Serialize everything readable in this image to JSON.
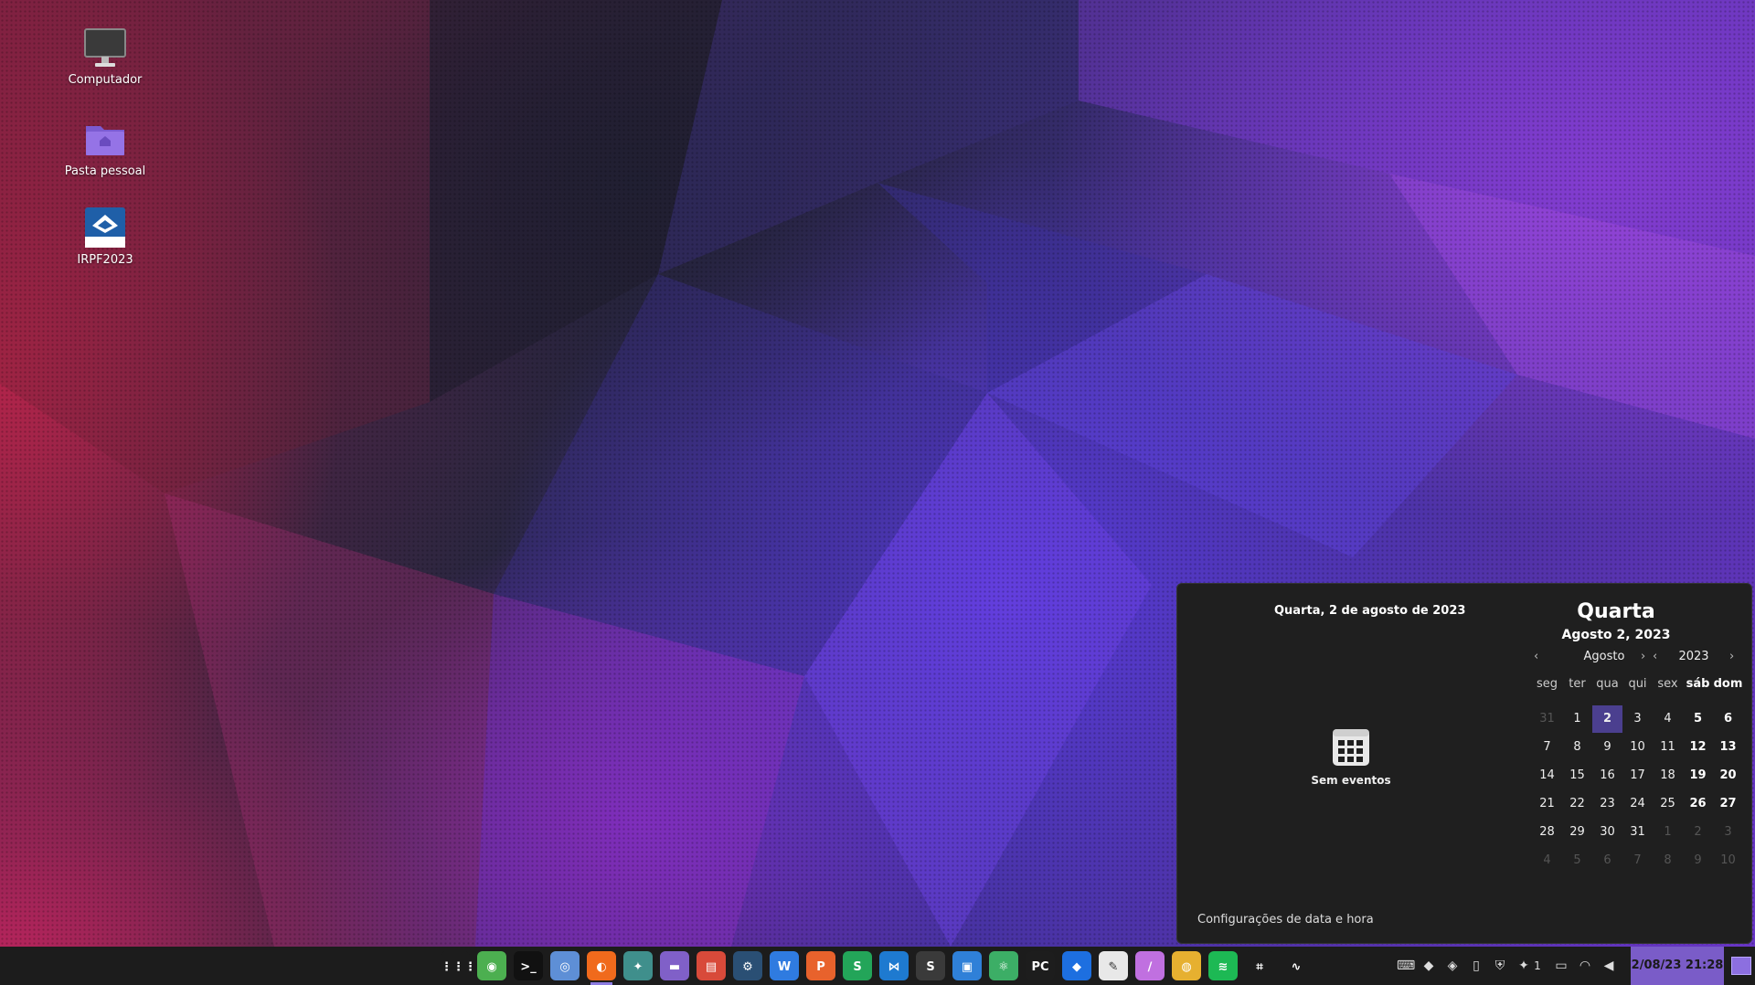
{
  "desktop": {
    "icons": [
      {
        "label": "Computador",
        "icon": "monitor-icon"
      },
      {
        "label": "Pasta pessoal",
        "icon": "home-folder-icon"
      },
      {
        "label": "IRPF2023",
        "icon": "irpf-app-icon"
      }
    ]
  },
  "calendar_popup": {
    "full_date": "Quarta, 2 de agosto de 2023",
    "no_events": "Sem eventos",
    "settings_link": "Configurações de data e hora",
    "weekday": "Quarta",
    "sub_date": "Agosto 2, 2023",
    "month": "Agosto",
    "year": "2023",
    "weekday_headers": [
      "seg",
      "ter",
      "qua",
      "qui",
      "sex",
      "sáb",
      "dom"
    ],
    "weeks": [
      [
        "31",
        "1",
        "2",
        "3",
        "4",
        "5",
        "6"
      ],
      [
        "7",
        "8",
        "9",
        "10",
        "11",
        "12",
        "13"
      ],
      [
        "14",
        "15",
        "16",
        "17",
        "18",
        "19",
        "20"
      ],
      [
        "21",
        "22",
        "23",
        "24",
        "25",
        "26",
        "27"
      ],
      [
        "28",
        "29",
        "30",
        "31",
        "1",
        "2",
        "3"
      ],
      [
        "4",
        "5",
        "6",
        "7",
        "8",
        "9",
        "10"
      ]
    ],
    "selected_day": "2"
  },
  "taskbar": {
    "apps": [
      {
        "name": "app-grid",
        "icon": "grid-icon",
        "color": "#1c1c1c"
      },
      {
        "name": "app-chrome-like",
        "icon": "globe-icon",
        "color": "#4caf50"
      },
      {
        "name": "app-terminal",
        "icon": "terminal-icon",
        "color": "#111111"
      },
      {
        "name": "app-chromium",
        "icon": "chromium-icon",
        "color": "#5e8fd6"
      },
      {
        "name": "app-firefox",
        "icon": "firefox-icon",
        "color": "#f06a1c"
      },
      {
        "name": "app-safari-like",
        "icon": "compass-icon",
        "color": "#3f8f8c"
      },
      {
        "name": "app-files",
        "icon": "folder-icon",
        "color": "#8060c8"
      },
      {
        "name": "app-store",
        "icon": "store-icon",
        "color": "#d84a3a"
      },
      {
        "name": "app-steam",
        "icon": "steam-icon",
        "color": "#2a4f74"
      },
      {
        "name": "app-wps-writer",
        "icon": "writer-icon",
        "color": "#2f7be0"
      },
      {
        "name": "app-wps-presentation",
        "icon": "presentation-icon",
        "color": "#e8622c"
      },
      {
        "name": "app-wps-spreadsheet",
        "icon": "spreadsheet-icon",
        "color": "#23a559"
      },
      {
        "name": "app-vscode",
        "icon": "vscode-icon",
        "color": "#1e7ad0"
      },
      {
        "name": "app-sublime",
        "icon": "sublime-icon",
        "color": "#3a3a3a"
      },
      {
        "name": "app-boxes",
        "icon": "boxes-icon",
        "color": "#2f80d8"
      },
      {
        "name": "app-atom",
        "icon": "atom-icon",
        "color": "#3cae66"
      },
      {
        "name": "app-pycharm",
        "icon": "pycharm-icon",
        "color": "#1d1d1d"
      },
      {
        "name": "app-dropbox",
        "icon": "dropbox-icon",
        "color": "#1d6fe0"
      },
      {
        "name": "app-gimp",
        "icon": "gimp-icon",
        "color": "#e8e8e8"
      },
      {
        "name": "app-drawing",
        "icon": "brush-icon",
        "color": "#c070e0"
      },
      {
        "name": "app-camera",
        "icon": "camera-icon",
        "color": "#e6b030"
      },
      {
        "name": "app-spotify",
        "icon": "spotify-icon",
        "color": "#1db954"
      },
      {
        "name": "app-screenshot",
        "icon": "crop-icon",
        "color": "#1c1c1c"
      },
      {
        "name": "app-monitor",
        "icon": "system-monitor-icon",
        "color": "#1c1c1c"
      }
    ],
    "tray": [
      "keyboard-icon",
      "dropbox-tray-icon",
      "color-picker-icon",
      "clipboard-icon",
      "shield-icon",
      "notification-icon",
      "printer-icon",
      "wifi-icon",
      "volume-icon"
    ],
    "notification_count": "1",
    "clock": "2/08/23 21:28"
  }
}
